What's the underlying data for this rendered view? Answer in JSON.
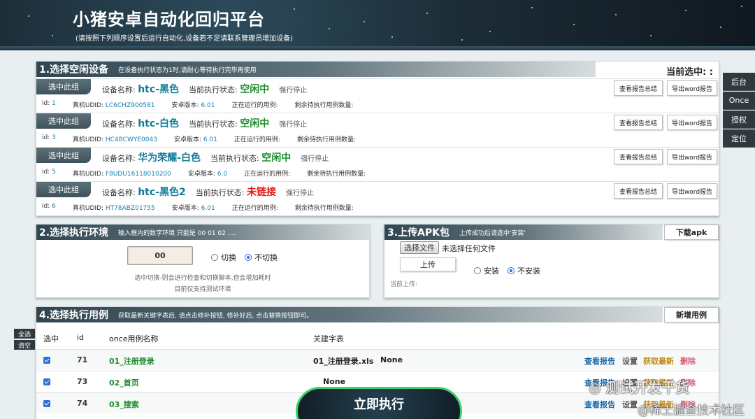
{
  "header": {
    "title": "小猪安卓自动化回归平台",
    "subtitle": "(请按照下列顺序设置后运行自动化,设备若不足请联系管理员增加设备)"
  },
  "side_buttons": [
    "后台",
    "Once",
    "授权",
    "定位"
  ],
  "devices_panel": {
    "title": "1.选择空闲设备",
    "hint": "在设备执行状态为1时,请耐心等待执行完毕再使用",
    "current_selection": "当前选中: :",
    "select_label": "选中此组",
    "name_label": "设备名称:",
    "status_label": "当前执行状态:",
    "stop_label": "强行停止",
    "report_btn": "查看报告总结",
    "export_btn": "导出word报告",
    "id_label": "id:",
    "udid_label": "真机UDID:",
    "version_label": "安卓版本:",
    "running_label": "正在运行的用例:",
    "remaining_label": "剩余待执行用例数量:",
    "devices": [
      {
        "name": "htc-黑色",
        "status": "空闲中",
        "status_type": "idle",
        "id": "1",
        "udid": "LC6CHZ900581",
        "version": "6.01"
      },
      {
        "name": "htc-白色",
        "status": "空闲中",
        "status_type": "idle",
        "id": "3",
        "udid": "HC4BCWYE0043",
        "version": "6.01"
      },
      {
        "name": "华为荣耀-白色",
        "status": "空闲中",
        "status_type": "idle",
        "id": "5",
        "udid": "F8UDU16118010200",
        "version": "6.0"
      },
      {
        "name": "htc-黑色2",
        "status": "未链接",
        "status_type": "off",
        "id": "6",
        "udid": "HT78ABZ01755",
        "version": "6.01"
      }
    ]
  },
  "env_panel": {
    "title": "2.选择执行环境",
    "hint": "输入框内的数字环境 只能是 00 01 02 ....",
    "value": "00",
    "opt_switch": "切换",
    "opt_noswitch": "不切换",
    "note1": "选中切换-则会进行检查和切换脚本,但会增加耗时",
    "note2": "目前仅支持测试环境"
  },
  "apk_panel": {
    "title": "3.上传APK包",
    "hint": "上传成功后请选中'安装'",
    "download_btn": "下载apk",
    "file_btn": "选择文件",
    "file_status": "未选择任何文件",
    "upload_btn": "上传",
    "opt_install": "安装",
    "opt_noinstall": "不安装",
    "current_upload": "当前上传:"
  },
  "cases_panel": {
    "title": "4.选择执行用例",
    "hint": "获取最新关键字表后, 请点击修补按钮, 修补好后, 点击替换按钮即可。",
    "add_btn": "新增用例",
    "select_all": "全选",
    "clear": "清空",
    "columns": {
      "sel": "选中",
      "id": "id",
      "name": "once用例名称",
      "kw": "关建字表"
    },
    "actions": {
      "report": "查看报告",
      "settings": "设置",
      "fetch": "获取最新",
      "delete": "删除"
    },
    "rows": [
      {
        "id": "71",
        "name": "01_注册登录",
        "kw_file": "01_注册登录.xls",
        "kw_extra": "None"
      },
      {
        "id": "73",
        "name": "02_首页",
        "kw_file": "",
        "kw_extra": "None"
      },
      {
        "id": "74",
        "name": "03_搜索",
        "kw_file": "",
        "kw_extra": ""
      }
    ]
  },
  "run_button": "立即执行",
  "watermark": {
    "line1": "测试开发干货",
    "line2": "@稀土掘金技术社区"
  }
}
